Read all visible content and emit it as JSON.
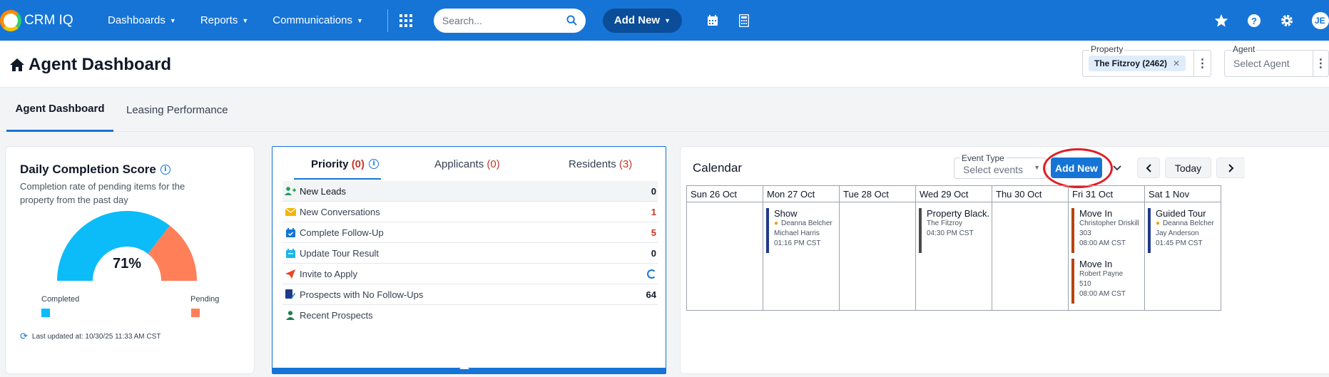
{
  "app": {
    "name": "CRM IQ"
  },
  "nav": {
    "menus": [
      "Dashboards",
      "Reports",
      "Communications"
    ],
    "search_placeholder": "Search...",
    "add_new": "Add New",
    "avatar_initials": "JE"
  },
  "header": {
    "title": "Agent Dashboard",
    "property_label": "Property",
    "property_value": "The Fitzroy (2462)",
    "agent_label": "Agent",
    "agent_placeholder": "Select Agent"
  },
  "tabs": [
    "Agent Dashboard",
    "Leasing Performance"
  ],
  "score": {
    "title": "Daily Completion Score",
    "subtitle": "Completion rate of pending items for the property from the past day",
    "percent_label": "71%",
    "completed_fraction": 0.71,
    "legend_completed": "Completed",
    "legend_pending": "Pending",
    "completed_color": "#0bbcf8",
    "pending_color": "#ff7f59",
    "updated": "Last updated at: 10/30/25 11:33 AM CST"
  },
  "priority": {
    "tabs": [
      {
        "label": "Priority",
        "count": "(0)"
      },
      {
        "label": "Applicants",
        "count": "(0)"
      },
      {
        "label": "Residents",
        "count": "(3)"
      }
    ],
    "rows": [
      {
        "label": "New Leads",
        "value": "0",
        "icon": "add-user-icon"
      },
      {
        "label": "New Conversations",
        "value": "1",
        "icon": "envelope-icon"
      },
      {
        "label": "Complete Follow-Up",
        "value": "5",
        "icon": "calendar-check-icon"
      },
      {
        "label": "Update Tour Result",
        "value": "0",
        "icon": "calendar-icon"
      },
      {
        "label": "Invite to Apply",
        "value": "",
        "icon": "paper-plane-icon"
      },
      {
        "label": "Prospects with No Follow-Ups",
        "value": "64",
        "icon": "edit-document-icon"
      },
      {
        "label": "Recent Prospects",
        "value": "",
        "icon": "person-icon"
      }
    ]
  },
  "calendar": {
    "title": "Calendar",
    "event_type_label": "Event Type",
    "event_type_placeholder": "Select events",
    "add_new": "Add New",
    "today": "Today",
    "days": [
      {
        "label": "Sun 26  Oct"
      },
      {
        "label": "Mon 27  Oct"
      },
      {
        "label": "Tue 28  Oct"
      },
      {
        "label": "Wed 29  Oct"
      },
      {
        "label": "Thu 30  Oct"
      },
      {
        "label": "Fri 31  Oct"
      },
      {
        "label": "Sat 1  Nov"
      }
    ],
    "events": {
      "mon_show": {
        "title": "Show",
        "agent": "Deanna Belcher",
        "name": "Michael Harris",
        "time": "01:16 PM CST"
      },
      "wed_property": {
        "title": "Property Black...",
        "place": "The Fitzroy",
        "time": "04:30 PM CST"
      },
      "fri_movein1": {
        "title": "Move In",
        "name": "Christopher Driskill",
        "unit": "303",
        "time": "08:00 AM CST"
      },
      "fri_movein2": {
        "title": "Move In",
        "name": "Robert Payne",
        "unit": "510",
        "time": "08:00 AM CST"
      },
      "sat_tour": {
        "title": "Guided Tour",
        "agent": "Deanna Belcher",
        "name": "Jay Anderson",
        "time": "01:45 PM CST"
      }
    }
  }
}
